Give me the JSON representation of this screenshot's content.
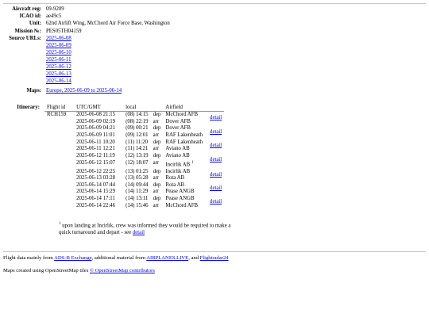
{
  "aircraft": {
    "reg_label": "Aircraft reg:",
    "reg": "09-9209",
    "icao_label": "ICAO id:",
    "icao": "ae49c5",
    "unit_label": "Unit:",
    "unit": "62nd Airlift Wing, McChord Air Force Base, Washington",
    "mission_label": "Mission №:",
    "mission": "PES05TH04159"
  },
  "sources": {
    "label": "Source URLs:",
    "links": [
      "2025-06-08",
      "2025-06-09",
      "2025-06-10",
      "2025-06-11",
      "2025-06-12",
      "2025-06-13",
      "2025-06-14"
    ]
  },
  "maps": {
    "label": "Maps:",
    "link": "Europe, 2025-06-09 to 2025-06-14"
  },
  "itinerary": {
    "label": "Itinerary:",
    "columns": [
      "Flight id",
      "UTC/GMT",
      "local",
      "",
      "Airfield"
    ],
    "flight_id": "RCH159",
    "detail_label": "detail",
    "legs": [
      {
        "dep_utc": "2025-06-08 21:15",
        "dep_local": "(08) 14:15",
        "dep_field": "McChord AFB",
        "arr_utc": "2025-06-09 02:19",
        "arr_local": "(08) 22:19",
        "arr_field": "Dover AFB",
        "dep_dir": "dep",
        "arr_dir": "arr",
        "note": ""
      },
      {
        "dep_utc": "2025-06-09 04:21",
        "dep_local": "(09) 00:21",
        "dep_field": "Dover AFB",
        "arr_utc": "2025-06-09 11:01",
        "arr_local": "(09) 12:01",
        "arr_field": "RAF Lakenheath",
        "dep_dir": "dep",
        "arr_dir": "arr",
        "note": ""
      },
      {
        "dep_utc": "2025-06-11 10:20",
        "dep_local": "(11) 11:20",
        "dep_field": "RAF Lakenheath",
        "arr_utc": "2025-06-11 12:21",
        "arr_local": "(11) 14:21",
        "arr_field": "Aviano AB",
        "dep_dir": "dep",
        "arr_dir": "arr",
        "note": ""
      },
      {
        "dep_utc": "2025-06-12 11:19",
        "dep_local": "(12) 13:19",
        "dep_field": "Aviano AB",
        "arr_utc": "2025-06-12 15:07",
        "arr_local": "(12) 18:07",
        "arr_field": "Incirlik AB",
        "dep_dir": "dep",
        "arr_dir": "arr",
        "note": "1"
      },
      {
        "dep_utc": "2025-06-12 22:25",
        "dep_local": "(13) 01:25",
        "dep_field": "Incirlik AB",
        "arr_utc": "2025-06-13 03:28",
        "arr_local": "(13) 05:28",
        "arr_field": "Rota AB",
        "dep_dir": "dep",
        "arr_dir": "arr",
        "note": ""
      },
      {
        "dep_utc": "2025-06-14 07:44",
        "dep_local": "(14) 09:44",
        "dep_field": "Rota AB",
        "arr_utc": "2025-06-14 15:29",
        "arr_local": "(14) 11:29",
        "arr_field": "Pease ANGB",
        "dep_dir": "dep",
        "arr_dir": "arr",
        "note": ""
      },
      {
        "dep_utc": "2025-06-14 17:11",
        "dep_local": "(14) 13:11",
        "dep_field": "Pease ANGB",
        "arr_utc": "2025-06-14 22:46",
        "arr_local": "(14) 15:46",
        "arr_field": "McChord AFB",
        "dep_dir": "dep",
        "arr_dir": "arr",
        "note": ""
      }
    ]
  },
  "footnote": {
    "mark": "1",
    "text": "upon landing at Incirlik, crew was informed they would be required to make a quick turnaround and depart - see",
    "link": "detail"
  },
  "credits": {
    "prefix": "Flight data mainly from",
    "adsb": "ADS-B Exchange",
    "mid": ", additional material from",
    "airplanes": "AIRPLANES.LIVE",
    "and": ", and",
    "fr24": "Flightradar24"
  },
  "map_credit": {
    "prefix": "Maps created using OpenStreetMap tiles",
    "link": "© OpenStreetMap contributors"
  }
}
